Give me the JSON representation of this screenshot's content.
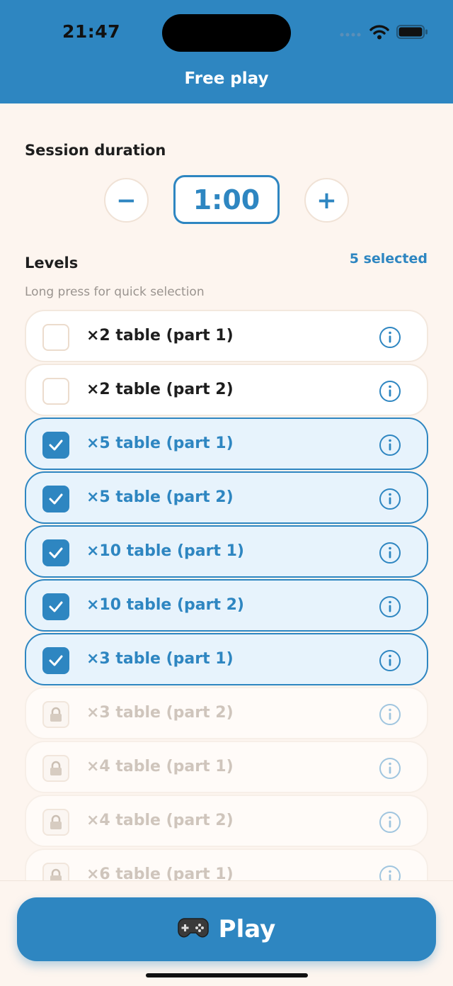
{
  "status_bar": {
    "time": "21:47"
  },
  "header": {
    "title": "Free play"
  },
  "session": {
    "label": "Session duration",
    "decrement_label": "−",
    "increment_label": "+",
    "value": "1:00"
  },
  "levels": {
    "label": "Levels",
    "selected_count": "5 selected",
    "hint": "Long press for quick selection",
    "items": [
      {
        "label": "×2 table (part 1)",
        "state": "unselected"
      },
      {
        "label": "×2 table (part 2)",
        "state": "unselected"
      },
      {
        "label": "×5 table (part 1)",
        "state": "selected"
      },
      {
        "label": "×5 table (part 2)",
        "state": "selected"
      },
      {
        "label": "×10 table (part 1)",
        "state": "selected"
      },
      {
        "label": "×10 table (part 2)",
        "state": "selected"
      },
      {
        "label": "×3 table (part 1)",
        "state": "selected"
      },
      {
        "label": "×3 table (part 2)",
        "state": "locked"
      },
      {
        "label": "×4 table (part 1)",
        "state": "locked"
      },
      {
        "label": "×4 table (part 2)",
        "state": "locked"
      },
      {
        "label": "×6 table (part 1)",
        "state": "locked"
      }
    ]
  },
  "play_button": {
    "label": "Play",
    "icon": "gamepad-icon"
  },
  "colors": {
    "accent": "#2e86c1",
    "background": "#fdf5ef",
    "selected_row": "#e7f3fc"
  }
}
